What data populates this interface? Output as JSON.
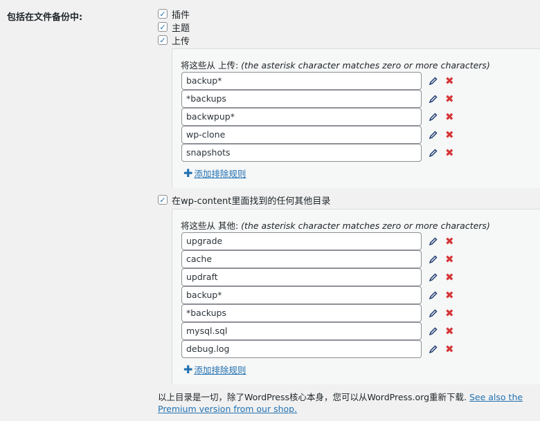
{
  "setting_label": "包括在文件备份中:",
  "checks": {
    "plugins": "插件",
    "themes": "主题",
    "uploads": "上传",
    "others": "在wp-content里面找到的任何其他目录"
  },
  "uploads_panel": {
    "heading_cn": "将这些从 上传: ",
    "heading_en": "(the asterisk character matches zero or more characters)",
    "items": [
      "backup*",
      "*backups",
      "backwpup*",
      "wp-clone",
      "snapshots"
    ],
    "add_rule": "添加排除规则"
  },
  "others_panel": {
    "heading_cn": "将这些从 其他: ",
    "heading_en": "(the asterisk character matches zero or more characters)",
    "items": [
      "upgrade",
      "cache",
      "updraft",
      "backup*",
      "*backups",
      "mysql.sql",
      "debug.log"
    ],
    "add_rule": "添加排除规则"
  },
  "footer": {
    "text": "以上目录是一切，除了WordPress核心本身，您可以从WordPress.org重新下载. ",
    "link": "See also the Premium version from our shop."
  }
}
